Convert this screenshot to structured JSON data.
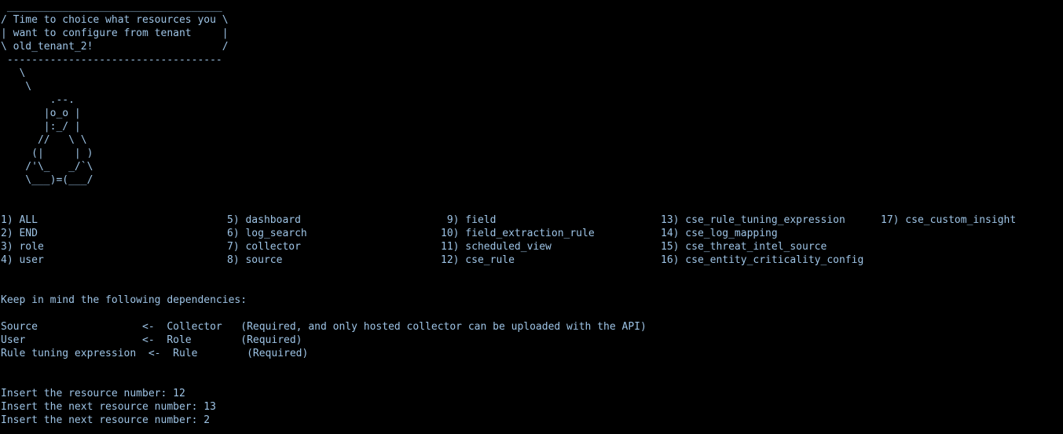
{
  "terminal": {
    "text_color": "#9ec4e6",
    "background_color": "#000000",
    "cowsay": {
      "bubble": [
        " ___________________________________",
        "/ Time to choice what resources you \\",
        "| want to configure from tenant     |",
        "\\ old_tenant_2!                     /",
        " -----------------------------------"
      ],
      "figure": [
        "   \\",
        "    \\",
        "        .--.",
        "       |o_o |",
        "       |:_/ |",
        "      //   \\ \\",
        "     (|     | )",
        "    /'\\_   _/`\\",
        "    \\___)=(___/"
      ]
    },
    "menu": {
      "col1": [
        "1) ALL",
        "2) END",
        "3) role",
        "4) user"
      ],
      "col2": [
        "5) dashboard",
        "6) log_search",
        "7) collector",
        "8) source"
      ],
      "col3": [
        " 9) field",
        "10) field_extraction_rule",
        "11) scheduled_view",
        "12) cse_rule"
      ],
      "col4": [
        "13) cse_rule_tuning_expression",
        "14) cse_log_mapping",
        "15) cse_threat_intel_source",
        "16) cse_entity_criticality_config"
      ],
      "col5": [
        "17) cse_custom_insight"
      ]
    },
    "dependencies": {
      "heading": "Keep in mind the following dependencies:",
      "rows": [
        "Source                 <-  Collector   (Required, and only hosted collector can be uploaded with the API)",
        "User                   <-  Role        (Required)",
        "Rule tuning expression  <-  Rule        (Required)"
      ]
    },
    "prompts": [
      "Insert the resource number: 12",
      "Insert the next resource number: 13",
      "Insert the next resource number: 2"
    ]
  }
}
